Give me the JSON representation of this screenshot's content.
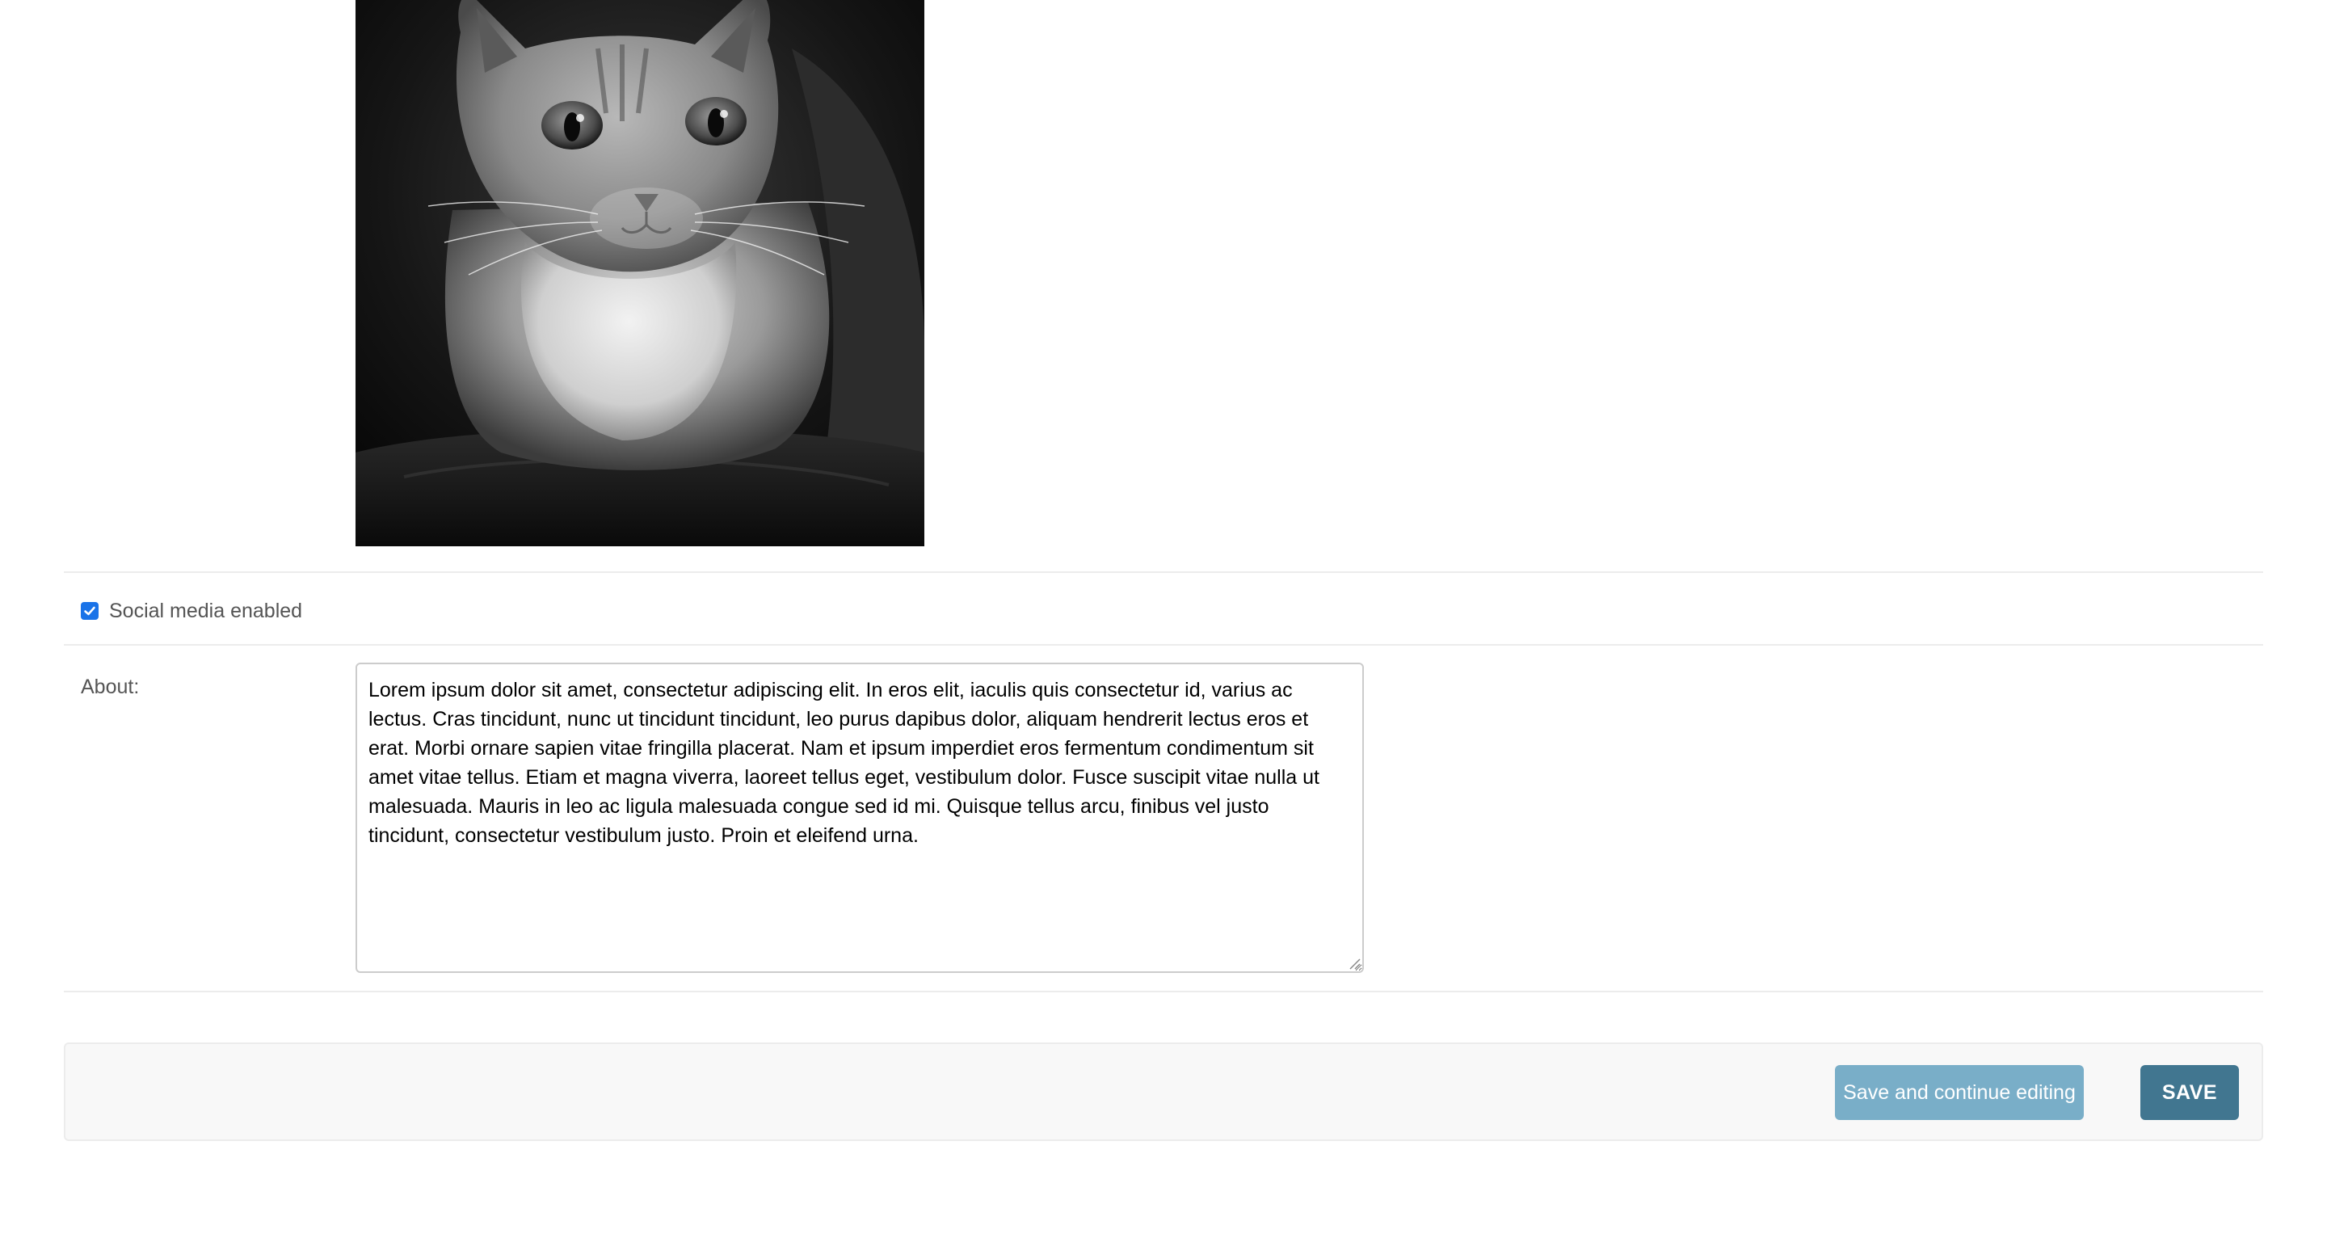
{
  "photo": {
    "alt": "cat-photo",
    "description_icon": "cat-photo-image"
  },
  "form": {
    "social_media": {
      "label": "Social media enabled",
      "checked": true
    },
    "about": {
      "label": "About:",
      "value": "Lorem ipsum dolor sit amet, consectetur adipiscing elit. In eros elit, iaculis quis consectetur id, varius ac lectus. Cras tincidunt, nunc ut tincidunt tincidunt, leo purus dapibus dolor, aliquam hendrerit lectus eros et erat. Morbi ornare sapien vitae fringilla placerat. Nam et ipsum imperdiet eros fermentum condimentum sit amet vitae tellus. Etiam et magna viverra, laoreet tellus eget, vestibulum dolor. Fusce suscipit vitae nulla ut malesuada. Mauris in leo ac ligula malesuada congue sed id mi. Quisque tellus arcu, finibus vel justo tincidunt, consectetur vestibulum justo. Proin et eleifend urna."
    }
  },
  "submit_row": {
    "continue_label": "Save and continue editing",
    "save_label": "SAVE"
  },
  "colors": {
    "checkbox_accent": "#1a73e8",
    "continue_button": "#79aec8",
    "save_button": "#417690",
    "submit_row_bg": "#f8f8f8"
  }
}
